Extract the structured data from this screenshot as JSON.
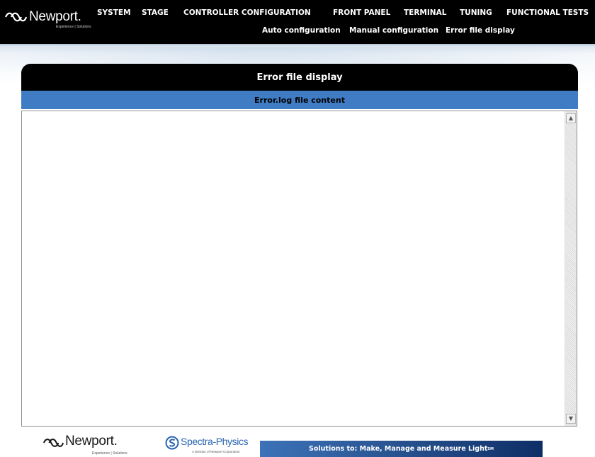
{
  "header": {
    "brand": {
      "name": "Newport.",
      "tagline": "Experience | Solutions"
    },
    "main_nav": [
      {
        "label": "SYSTEM"
      },
      {
        "label": "STAGE"
      },
      {
        "label": "CONTROLLER CONFIGURATION"
      },
      {
        "label": "FRONT PANEL"
      },
      {
        "label": "TERMINAL"
      },
      {
        "label": "TUNING"
      },
      {
        "label": "FUNCTIONAL TESTS"
      }
    ],
    "sub_nav": [
      {
        "label": "Auto configuration"
      },
      {
        "label": "Manual configuration"
      },
      {
        "label": "Error file display"
      }
    ]
  },
  "panel": {
    "title": "Error file display",
    "subtitle": "Error.log file content",
    "file_content": ""
  },
  "footer": {
    "newport": {
      "name": "Newport.",
      "tagline": "Experience | Solutions"
    },
    "spectra_physics": {
      "name": "Spectra-Physics",
      "tagline": "A Division of Newport Corporation"
    },
    "banner": {
      "text": "Solutions to: Make, Manage and Measure Light",
      "mark": "SM"
    }
  },
  "colors": {
    "topbar": "#000000",
    "panel_header": "#000000",
    "subheader": "#3f7cc4",
    "banner_start": "#3c72b8",
    "banner_end": "#0e2e66",
    "spectra_blue": "#2a64b0"
  },
  "icons": {
    "brand": "newport-logo-icon",
    "footer_brand": "spectra-physics-logo-icon",
    "scroll_up": "chevron-up-icon",
    "scroll_down": "chevron-down-icon"
  }
}
